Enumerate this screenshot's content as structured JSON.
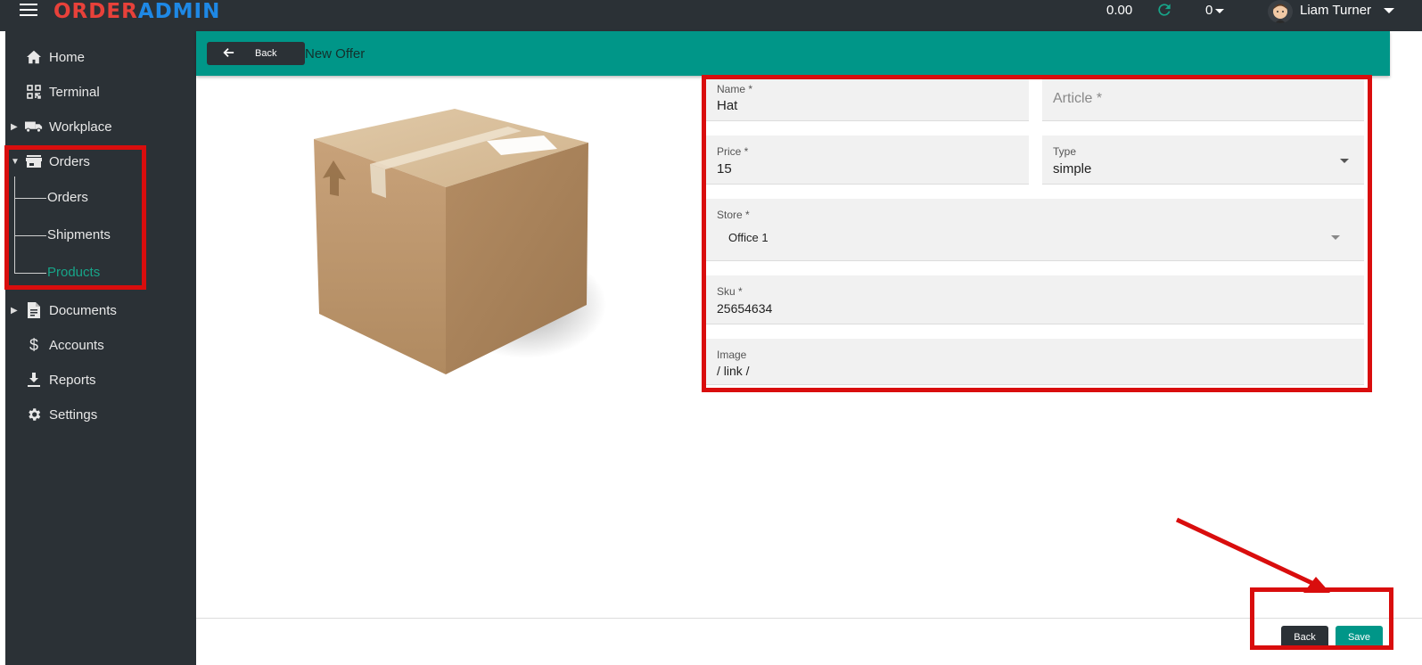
{
  "topbar": {
    "logo_part1": "ORDER",
    "logo_part2": "ADMIN",
    "balance": "0.00",
    "counter": "0",
    "username": "Liam Turner"
  },
  "sidebar": {
    "items": [
      {
        "label": "Home",
        "icon": "home-icon"
      },
      {
        "label": "Terminal",
        "icon": "qr-code-icon"
      },
      {
        "label": "Workplace",
        "icon": "truck-icon",
        "expandable": true
      },
      {
        "label": "Orders",
        "icon": "store-icon",
        "expanded": true
      },
      {
        "label": "Documents",
        "icon": "document-icon",
        "expandable": true
      },
      {
        "label": "Accounts",
        "icon": "dollar-icon"
      },
      {
        "label": "Reports",
        "icon": "download-icon"
      },
      {
        "label": "Settings",
        "icon": "gear-icon"
      }
    ],
    "orders_children": [
      {
        "label": "Orders"
      },
      {
        "label": "Shipments"
      },
      {
        "label": "Products",
        "active": true
      }
    ]
  },
  "header": {
    "back_label": "Back",
    "title": "New Offer"
  },
  "form": {
    "name": {
      "label": "Name *",
      "value": "Hat"
    },
    "article": {
      "placeholder": "Article *"
    },
    "price": {
      "label": "Price *",
      "value": "15"
    },
    "type": {
      "label": "Type",
      "value": "simple"
    },
    "store": {
      "label": "Store *",
      "value": "Office 1"
    },
    "sku": {
      "label": "Sku *",
      "value": "25654634"
    },
    "image": {
      "label": "Image",
      "value": "/ link /"
    }
  },
  "footer": {
    "back_label": "Back",
    "save_label": "Save"
  },
  "colors": {
    "sidebar_bg": "#2b3136",
    "accent": "#009688",
    "active_nav": "#17a589",
    "annotation": "#d90d0d",
    "logo_red": "#e8413a",
    "logo_blue": "#1e88e5"
  }
}
